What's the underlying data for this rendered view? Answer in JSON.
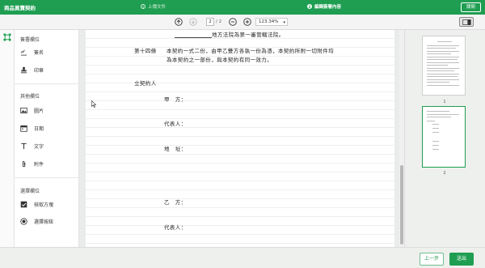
{
  "header": {
    "document_title": "商品買賣契約",
    "steps": [
      {
        "number": "1",
        "label": "上傳文件"
      },
      {
        "number": "2",
        "label": "編輯簽署內容"
      }
    ],
    "close_label": "關閉"
  },
  "toolbar": {
    "current_page": "2",
    "total_pages": "/ 2",
    "zoom": "123.34%"
  },
  "panel": {
    "sign_section_title": "簽署欄位",
    "sign_items": [
      {
        "label": "簽名",
        "icon": "signature-icon"
      },
      {
        "label": "印章",
        "icon": "stamp-icon"
      }
    ],
    "other_section_title": "其他欄位",
    "other_items": [
      {
        "label": "圖片",
        "icon": "image-icon"
      },
      {
        "label": "日期",
        "icon": "calendar-icon"
      },
      {
        "label": "文字",
        "icon": "text-icon"
      },
      {
        "label": "附件",
        "icon": "paperclip-icon"
      }
    ],
    "choice_section_title": "選擇欄位",
    "choice_items": [
      {
        "label": "核取方塊",
        "icon": "checkbox-icon"
      },
      {
        "label": "選擇按鈕",
        "icon": "radio-icon"
      }
    ]
  },
  "document": {
    "line_court": "地方法院為第一審管轄法院。",
    "article14_label": "第十四條",
    "article14_line1": "本契約一式二份，由甲乙雙方各執一份為憑，本契約所附一切附件均",
    "article14_line2": "為本契約之一部份，與本契約有同一效力。",
    "signatories": "立契約人",
    "party_a": "甲　方：",
    "representative_a": "代表人：",
    "address_a": "地　址：",
    "party_b": "乙　方：",
    "representative_b": "代表人："
  },
  "thumbnails": [
    {
      "page": "1"
    },
    {
      "page": "2"
    }
  ],
  "footer": {
    "prev_label": "上一步",
    "send_label": "送出"
  },
  "colors": {
    "brand": "#1f9e52"
  }
}
